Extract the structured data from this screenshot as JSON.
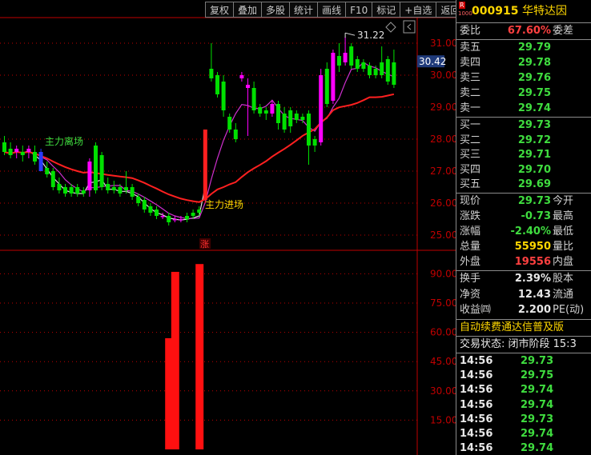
{
  "toolbar": {
    "buttons": [
      "复权",
      "叠加",
      "多股",
      "统计",
      "画线",
      "F10",
      "标记",
      "+自选",
      "返回"
    ]
  },
  "chart_data": {
    "type": "candlestick",
    "annotations": {
      "high_label": "31.22",
      "exit_label": "主力离场",
      "entry_label": "主力进场",
      "rise_marker": "涨",
      "current_price_tag": "30.42"
    },
    "price_axis": {
      "ticks": [
        "31.00",
        "30.00",
        "29.00",
        "28.00",
        "27.00",
        "26.00",
        "25.00"
      ],
      "ylim": [
        24.6,
        31.8
      ]
    },
    "volume_axis": {
      "ticks": [
        "90.00",
        "75.00",
        "60.00",
        "45.00",
        "30.00",
        "15.00"
      ],
      "ylim": [
        0,
        100
      ]
    },
    "candles": [
      {
        "o": 27.9,
        "h": 28.1,
        "l": 27.5,
        "c": 27.6
      },
      {
        "o": 27.7,
        "h": 27.9,
        "l": 27.4,
        "c": 27.5
      },
      {
        "o": 27.6,
        "h": 27.8,
        "l": 27.4,
        "c": 27.7
      },
      {
        "o": 27.6,
        "h": 27.8,
        "l": 27.3,
        "c": 27.5
      },
      {
        "o": 27.6,
        "h": 27.8,
        "l": 27.4,
        "c": 27.7
      },
      {
        "o": 27.6,
        "h": 27.8,
        "l": 27.2,
        "c": 27.3
      },
      {
        "o": 27.6,
        "h": 27.7,
        "l": 27.0,
        "c": 27.0
      },
      {
        "o": 27.1,
        "h": 27.3,
        "l": 26.8,
        "c": 26.9
      },
      {
        "o": 27.0,
        "h": 27.1,
        "l": 26.4,
        "c": 26.5
      },
      {
        "o": 26.6,
        "h": 26.8,
        "l": 26.3,
        "c": 26.4
      },
      {
        "o": 26.5,
        "h": 26.6,
        "l": 26.2,
        "c": 26.3
      },
      {
        "o": 26.5,
        "h": 26.6,
        "l": 26.2,
        "c": 26.3
      },
      {
        "o": 26.5,
        "h": 26.6,
        "l": 26.2,
        "c": 26.3
      },
      {
        "o": 26.4,
        "h": 26.5,
        "l": 26.2,
        "c": 26.3
      },
      {
        "o": 26.4,
        "h": 27.4,
        "l": 26.2,
        "c": 27.3
      },
      {
        "o": 27.8,
        "h": 27.9,
        "l": 26.3,
        "c": 26.4
      },
      {
        "o": 27.5,
        "h": 27.6,
        "l": 26.4,
        "c": 26.5
      },
      {
        "o": 26.6,
        "h": 26.8,
        "l": 26.3,
        "c": 26.4
      },
      {
        "o": 26.5,
        "h": 26.7,
        "l": 26.3,
        "c": 26.4
      },
      {
        "o": 26.5,
        "h": 26.6,
        "l": 26.2,
        "c": 26.3
      },
      {
        "o": 26.5,
        "h": 27.0,
        "l": 26.3,
        "c": 26.4
      },
      {
        "o": 26.5,
        "h": 26.6,
        "l": 26.1,
        "c": 26.2
      },
      {
        "o": 26.2,
        "h": 26.3,
        "l": 25.9,
        "c": 26.0
      },
      {
        "o": 26.1,
        "h": 26.2,
        "l": 25.7,
        "c": 25.8
      },
      {
        "o": 25.9,
        "h": 26.0,
        "l": 25.6,
        "c": 25.7
      },
      {
        "o": 25.8,
        "h": 25.9,
        "l": 25.5,
        "c": 25.6
      },
      {
        "o": 25.6,
        "h": 25.7,
        "l": 25.5,
        "c": 25.6
      },
      {
        "o": 25.6,
        "h": 25.7,
        "l": 25.3,
        "c": 25.4
      },
      {
        "o": 25.5,
        "h": 25.6,
        "l": 25.4,
        "c": 25.5
      },
      {
        "o": 25.5,
        "h": 25.6,
        "l": 25.4,
        "c": 25.5
      },
      {
        "o": 25.6,
        "h": 25.7,
        "l": 25.4,
        "c": 25.5
      },
      {
        "o": 25.7,
        "h": 25.8,
        "l": 25.5,
        "c": 25.6
      },
      {
        "o": 25.8,
        "h": 25.9,
        "l": 25.6,
        "c": 25.7
      },
      {
        "o": 26.1,
        "h": 28.3,
        "l": 26.0,
        "c": 28.3
      },
      {
        "o": 30.2,
        "h": 31.0,
        "l": 29.8,
        "c": 29.9
      },
      {
        "o": 30.0,
        "h": 30.1,
        "l": 29.3,
        "c": 29.4
      },
      {
        "o": 29.8,
        "h": 30.0,
        "l": 28.7,
        "c": 28.9
      },
      {
        "o": 28.7,
        "h": 28.8,
        "l": 28.2,
        "c": 28.3
      },
      {
        "o": 28.3,
        "h": 28.5,
        "l": 27.9,
        "c": 28.0
      },
      {
        "o": 29.9,
        "h": 30.1,
        "l": 29.8,
        "c": 30.0
      },
      {
        "o": 29.6,
        "h": 29.9,
        "l": 28.1,
        "c": 29.7
      },
      {
        "o": 29.6,
        "h": 29.8,
        "l": 28.8,
        "c": 28.9
      },
      {
        "o": 29.0,
        "h": 29.1,
        "l": 28.7,
        "c": 28.8
      },
      {
        "o": 28.9,
        "h": 29.0,
        "l": 28.6,
        "c": 28.8
      },
      {
        "o": 28.8,
        "h": 29.2,
        "l": 28.7,
        "c": 29.1
      },
      {
        "o": 29.1,
        "h": 29.2,
        "l": 28.3,
        "c": 28.5
      },
      {
        "o": 28.8,
        "h": 29.0,
        "l": 28.2,
        "c": 28.3
      },
      {
        "o": 28.9,
        "h": 29.0,
        "l": 28.2,
        "c": 28.4
      },
      {
        "o": 28.8,
        "h": 28.9,
        "l": 28.5,
        "c": 28.6
      },
      {
        "o": 28.7,
        "h": 28.8,
        "l": 28.5,
        "c": 28.6
      },
      {
        "o": 28.8,
        "h": 28.9,
        "l": 27.2,
        "c": 27.8
      },
      {
        "o": 28.0,
        "h": 28.1,
        "l": 27.6,
        "c": 27.8
      },
      {
        "o": 27.9,
        "h": 30.2,
        "l": 27.8,
        "c": 30.0
      },
      {
        "o": 30.2,
        "h": 30.4,
        "l": 29.0,
        "c": 29.1
      },
      {
        "o": 29.2,
        "h": 30.8,
        "l": 29.1,
        "c": 30.7
      },
      {
        "o": 30.6,
        "h": 31.0,
        "l": 30.1,
        "c": 30.3
      },
      {
        "o": 30.4,
        "h": 31.2,
        "l": 30.3,
        "c": 30.7
      },
      {
        "o": 30.9,
        "h": 31.0,
        "l": 30.2,
        "c": 30.3
      },
      {
        "o": 30.5,
        "h": 30.6,
        "l": 30.1,
        "c": 30.2
      },
      {
        "o": 30.4,
        "h": 30.5,
        "l": 30.1,
        "c": 30.2
      },
      {
        "o": 30.3,
        "h": 30.4,
        "l": 29.9,
        "c": 30.0
      },
      {
        "o": 30.2,
        "h": 30.3,
        "l": 29.9,
        "c": 30.0
      },
      {
        "o": 30.4,
        "h": 30.9,
        "l": 29.9,
        "c": 30.0
      },
      {
        "o": 30.5,
        "h": 30.6,
        "l": 29.7,
        "c": 29.8
      },
      {
        "o": 30.4,
        "h": 30.8,
        "l": 29.6,
        "c": 29.7
      }
    ],
    "volume_bars": [
      {
        "index": 27,
        "value": 57
      },
      {
        "index": 28,
        "value": 91
      },
      {
        "index": 32,
        "value": 95
      }
    ]
  },
  "panel": {
    "header": {
      "badge_top": "R",
      "badge_bottom": "1000",
      "code": "000915",
      "name": "华特达因"
    },
    "weibi": {
      "label": "委比",
      "value": "67.60%",
      "label2": "委差"
    },
    "sell": [
      {
        "label": "卖五",
        "price": "29.79"
      },
      {
        "label": "卖四",
        "price": "29.78"
      },
      {
        "label": "卖三",
        "price": "29.76"
      },
      {
        "label": "卖二",
        "price": "29.75"
      },
      {
        "label": "卖一",
        "price": "29.74"
      }
    ],
    "buy": [
      {
        "label": "买一",
        "price": "29.73"
      },
      {
        "label": "买二",
        "price": "29.72"
      },
      {
        "label": "买三",
        "price": "29.71"
      },
      {
        "label": "买四",
        "price": "29.70"
      },
      {
        "label": "买五",
        "price": "29.69"
      }
    ],
    "stats": [
      {
        "label": "现价",
        "value": "29.73",
        "label2": "今开",
        "color": "green"
      },
      {
        "label": "涨跌",
        "value": "-0.73",
        "label2": "最高",
        "color": "green"
      },
      {
        "label": "涨幅",
        "value": "-2.40%",
        "label2": "最低",
        "color": "green"
      },
      {
        "label": "总量",
        "value": "55950",
        "label2": "量比",
        "color": "yellow"
      },
      {
        "label": "外盘",
        "value": "19556",
        "label2": "内盘",
        "color": "red"
      }
    ],
    "stats2": [
      {
        "label": "换手",
        "value": "2.39%",
        "label2": "股本"
      },
      {
        "label": "净资",
        "value": "12.43",
        "label2": "流通"
      },
      {
        "label": "收益㈣",
        "value": "2.200",
        "label2": "PE(动)"
      }
    ],
    "promo": "自动续费通达信普及版",
    "status": "交易状态: 闭市阶段 15:3",
    "ticks": [
      {
        "time": "14:56",
        "price": "29.73"
      },
      {
        "time": "14:56",
        "price": "29.75"
      },
      {
        "time": "14:56",
        "price": "29.74"
      },
      {
        "time": "14:56",
        "price": "29.74"
      },
      {
        "time": "14:56",
        "price": "29.73"
      },
      {
        "time": "14:56",
        "price": "29.74"
      },
      {
        "time": "14:56",
        "price": "29.74"
      }
    ]
  },
  "colors": {
    "up": "#ff00ff",
    "down": "#00e000",
    "blue": "#2a3cff",
    "ma_slow": "#ff2020",
    "ma_mid": "#d030d0",
    "ma_fast": "#e0e0e0",
    "volume": "#ff1010",
    "axis": "#c00000"
  }
}
